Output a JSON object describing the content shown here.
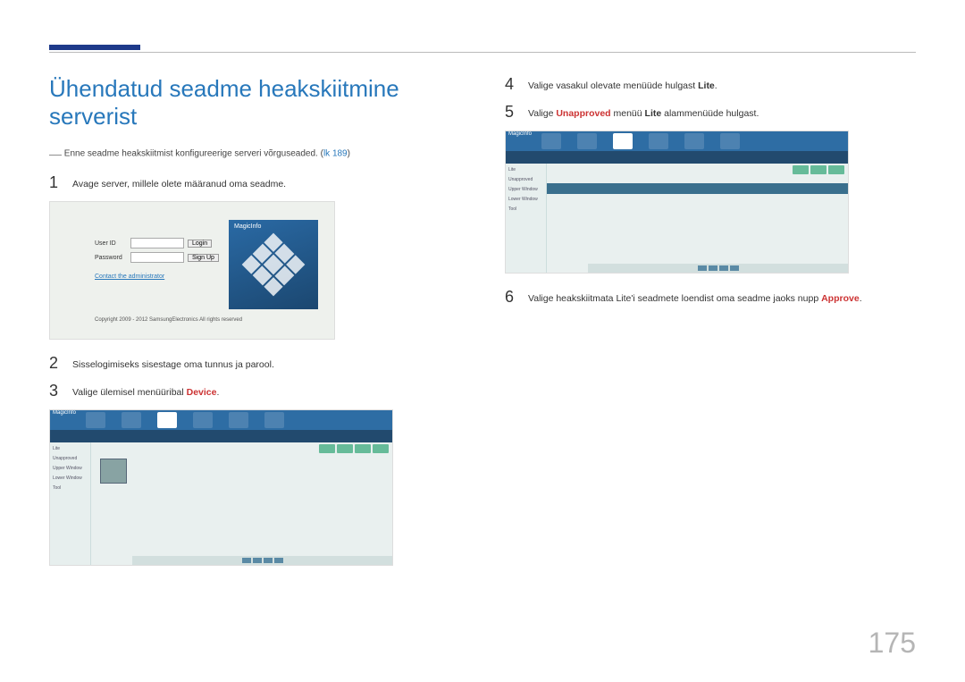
{
  "header": {},
  "title": "Ühendatud seadme heakskiitmine serverist",
  "footnote": {
    "pre": "Enne seadme heakskiitmist konfigureerige serveri võrguseaded. (",
    "link": "lk 189",
    "post": ")"
  },
  "steps": {
    "s1": {
      "num": "1",
      "text": "Avage server, millele olete määranud oma seadme."
    },
    "s2": {
      "num": "2",
      "text": "Sisselogimiseks sisestage oma tunnus ja parool."
    },
    "s3": {
      "num": "3",
      "pre": "Valige ülemisel menüüribal ",
      "kw": "Device",
      "post": "."
    },
    "s4": {
      "num": "4",
      "pre": "Valige vasakul olevate menüüde hulgast ",
      "kw": "Lite",
      "post": "."
    },
    "s5": {
      "num": "5",
      "pre": "Valige ",
      "kw1": "Unapproved",
      "mid": " menüü ",
      "kw2": "Lite",
      "post": " alammenüüde hulgast."
    },
    "s6": {
      "num": "6",
      "pre": "Valige heakskiitmata Lite'i seadmete loendist oma seadme jaoks nupp ",
      "kw": "Approve",
      "post": "."
    }
  },
  "login": {
    "user": "User ID",
    "pass": "Password",
    "loginBtn": "Login",
    "signup": "Sign Up",
    "contact": "Contact the administrator",
    "logo": "MagicInfo",
    "copy": "Copyright 2009 - 2012 SamsungElectronics All rights reserved"
  },
  "app": {
    "logo": "MagicInfo",
    "side": [
      "Lite",
      "Unapproved",
      "Upper Window",
      "Lower Window",
      "Tool"
    ]
  },
  "pageNumber": "175"
}
